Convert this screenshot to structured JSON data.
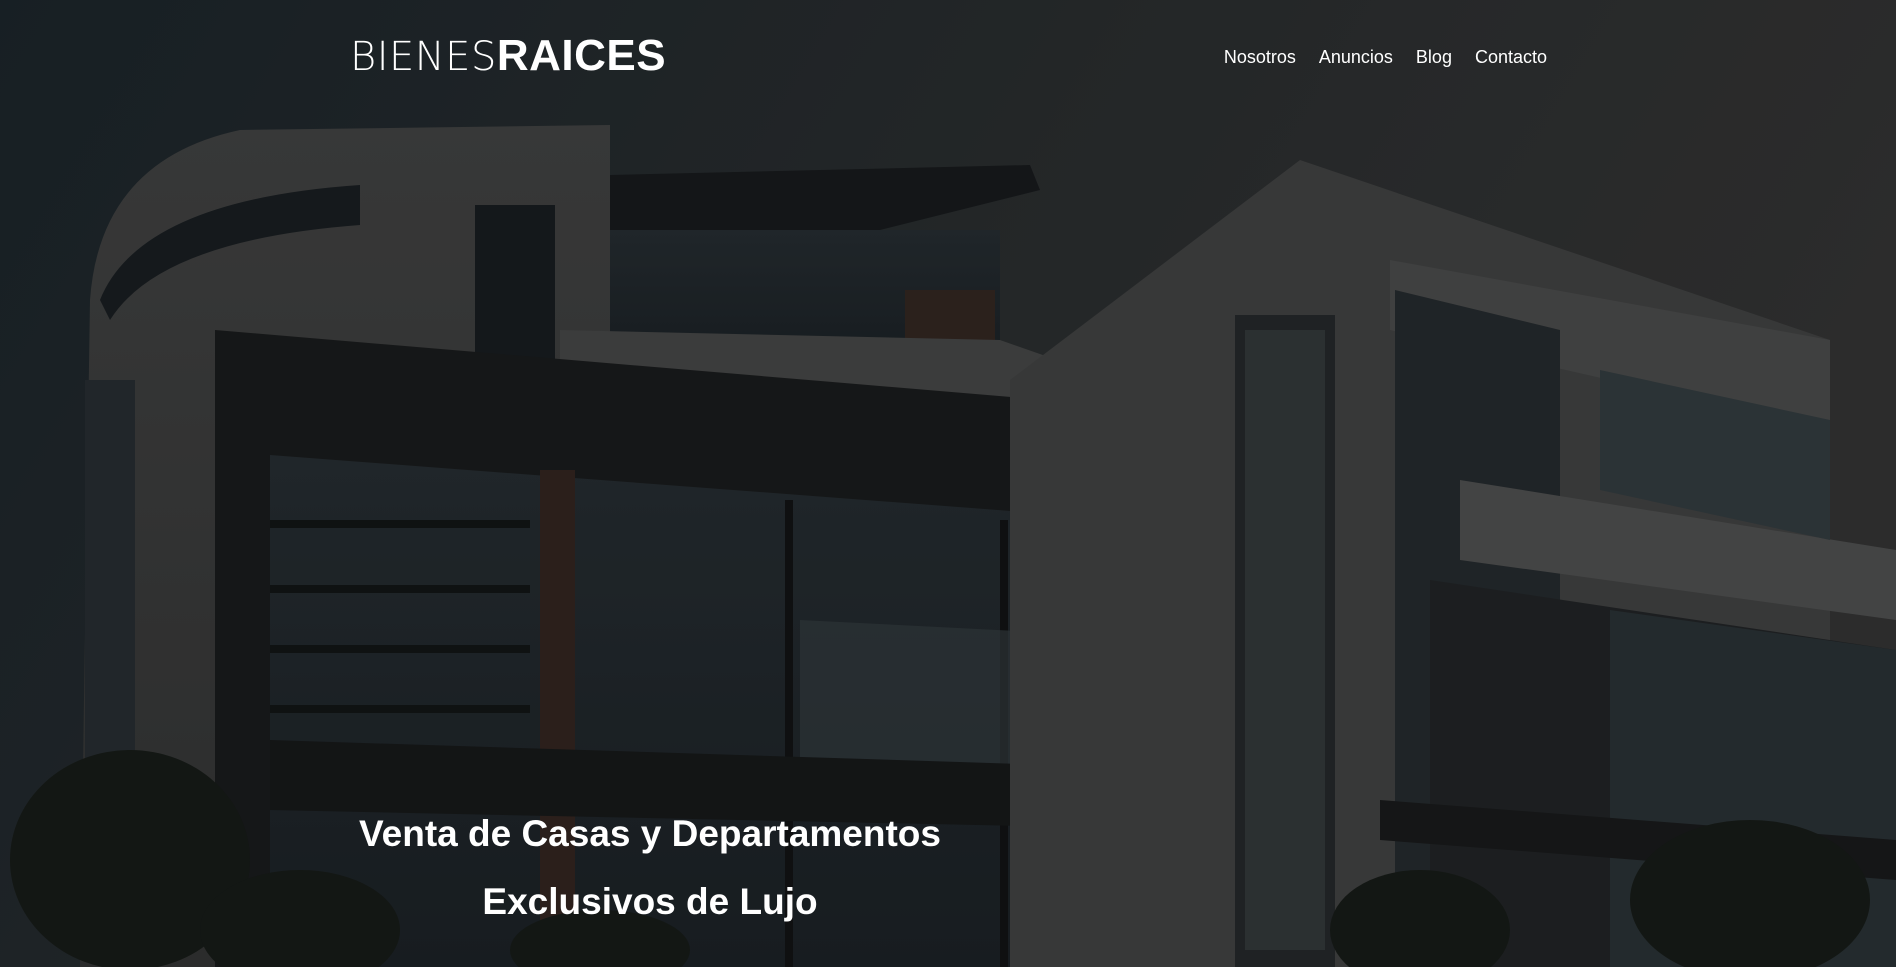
{
  "brand": {
    "name_light": "BIENES",
    "name_bold": "RAICES"
  },
  "nav": {
    "items": [
      {
        "label": "Nosotros"
      },
      {
        "label": "Anuncios"
      },
      {
        "label": "Blog"
      },
      {
        "label": "Contacto"
      }
    ]
  },
  "hero": {
    "title_line1": "Venta de Casas y Departamentos",
    "title_line2": "Exclusivos de Lujo"
  },
  "colors": {
    "text": "#ffffff",
    "overlay": "#2b3033"
  }
}
